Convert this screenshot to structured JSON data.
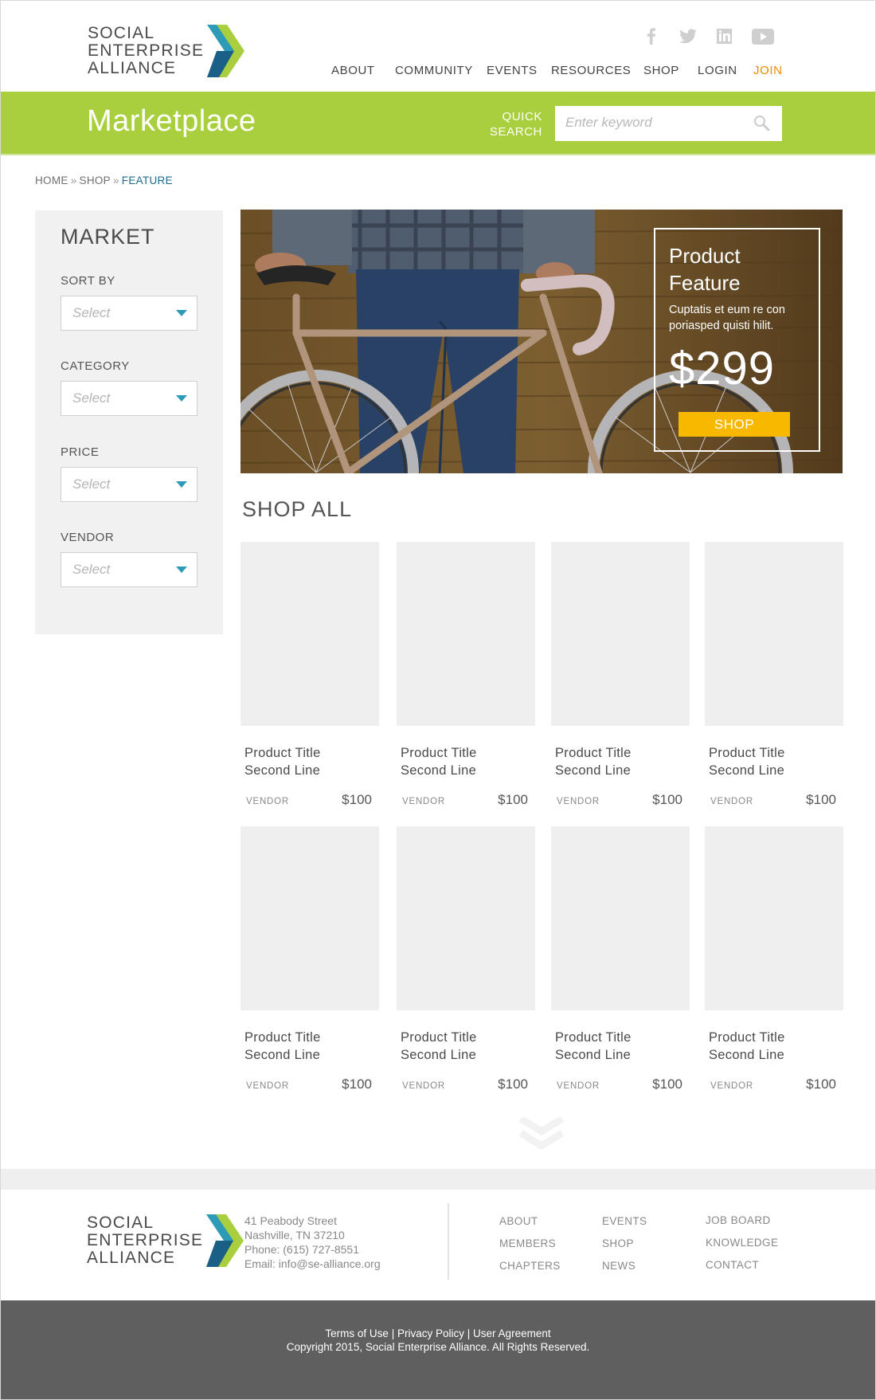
{
  "brand": {
    "line1": "SOCIAL",
    "line2": "ENTERPRISE",
    "line3": "ALLIANCE"
  },
  "social": [
    "facebook-icon",
    "twitter-icon",
    "linkedin-icon",
    "youtube-icon"
  ],
  "nav": {
    "about": "ABOUT",
    "community": "COMMUNITY",
    "events": "EVENTS",
    "resources": "RESOURCES",
    "shop": "SHOP",
    "login": "LOGIN",
    "join": "JOIN"
  },
  "colors": {
    "green": "#a9cf3e",
    "join": "#f08a00",
    "accent_blue": "#2d9ab7",
    "button_yellow": "#f9b800"
  },
  "banner": {
    "title": "Marketplace",
    "quick_line1": "QUICK",
    "quick_line2": "SEARCH",
    "search_placeholder": "Enter keyword"
  },
  "breadcrumb": {
    "home": "HOME",
    "shop": "SHOP",
    "current": "FEATURE",
    "sep": "»"
  },
  "sidebar": {
    "title": "MARKET",
    "filters": [
      {
        "label": "SORT BY",
        "value": "Select"
      },
      {
        "label": "CATEGORY",
        "value": "Select"
      },
      {
        "label": "PRICE",
        "value": "Select"
      },
      {
        "label": "VENDOR",
        "value": "Select"
      }
    ]
  },
  "feature": {
    "title_line1": "Product",
    "title_line2": "Feature",
    "description": "Cuptatis et eum re con poriasped quisti hilit.",
    "price": "$299",
    "button": "SHOP"
  },
  "shop_all": {
    "heading": "SHOP ALL",
    "products": [
      {
        "title1": "Product Title",
        "title2": "Second Line",
        "vendor": "VENDOR",
        "price": "$100"
      },
      {
        "title1": "Product Title",
        "title2": "Second Line",
        "vendor": "VENDOR",
        "price": "$100"
      },
      {
        "title1": "Product Title",
        "title2": "Second Line",
        "vendor": "VENDOR",
        "price": "$100"
      },
      {
        "title1": "Product Title",
        "title2": "Second Line",
        "vendor": "VENDOR",
        "price": "$100"
      },
      {
        "title1": "Product Title",
        "title2": "Second Line",
        "vendor": "VENDOR",
        "price": "$100"
      },
      {
        "title1": "Product Title",
        "title2": "Second Line",
        "vendor": "VENDOR",
        "price": "$100"
      },
      {
        "title1": "Product Title",
        "title2": "Second Line",
        "vendor": "VENDOR",
        "price": "$100"
      },
      {
        "title1": "Product Title",
        "title2": "Second Line",
        "vendor": "VENDOR",
        "price": "$100"
      }
    ]
  },
  "footer": {
    "address": [
      "41 Peabody Street",
      "Nashville, TN 37210",
      "Phone: (615) 727-8551",
      "Email: info@se-alliance.org"
    ],
    "links_col1": [
      "ABOUT",
      "MEMBERS",
      "CHAPTERS"
    ],
    "links_col2": [
      "EVENTS",
      "SHOP",
      "NEWS"
    ],
    "links_col3": [
      "JOB BOARD",
      "KNOWLEDGE",
      "CONTACT"
    ],
    "legal_terms": "Terms of Use",
    "legal_privacy": "Privacy Policy",
    "legal_agreement": "User Agreement",
    "legal_sep": "|",
    "copyright": "Copyright 2015, Social Enterprise Alliance. All Rights Reserved."
  }
}
